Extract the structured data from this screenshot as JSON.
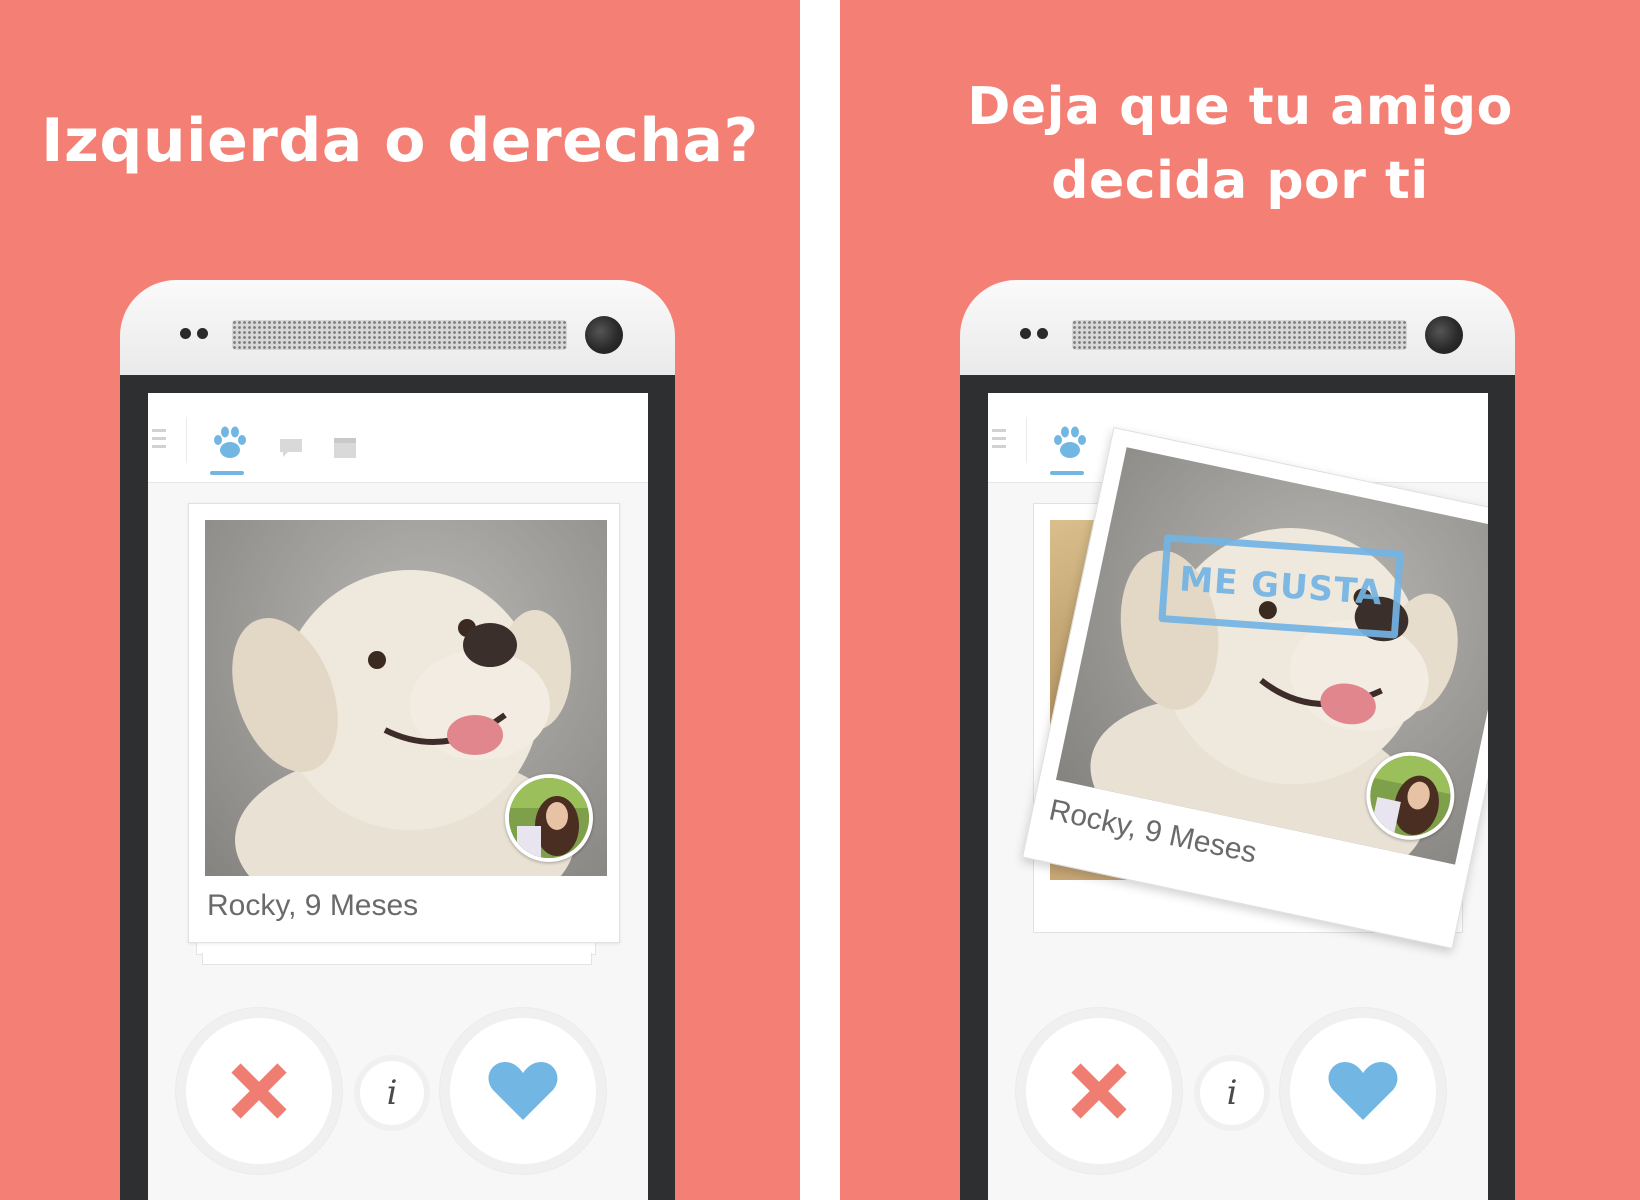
{
  "panels": [
    {
      "headline": "Izquierda o derecha?",
      "card_caption": "Rocky, 9 Meses"
    },
    {
      "headline_line1": "Deja que tu amigo",
      "headline_line2": "decida por ti",
      "card_caption": "Rocky, 9 Meses",
      "stamp": "ME GUSTA"
    }
  ],
  "buttons": {
    "info_label": "i"
  },
  "icons": {
    "nav": [
      "menu-icon",
      "paw-icon",
      "chat-icon",
      "calendar-icon"
    ],
    "actions": [
      "close-icon",
      "info-icon",
      "heart-icon"
    ]
  },
  "colors": {
    "background": "#f47f74",
    "accent_blue": "#72b7e3",
    "dislike": "#f07d72",
    "like": "#72b7e3"
  }
}
